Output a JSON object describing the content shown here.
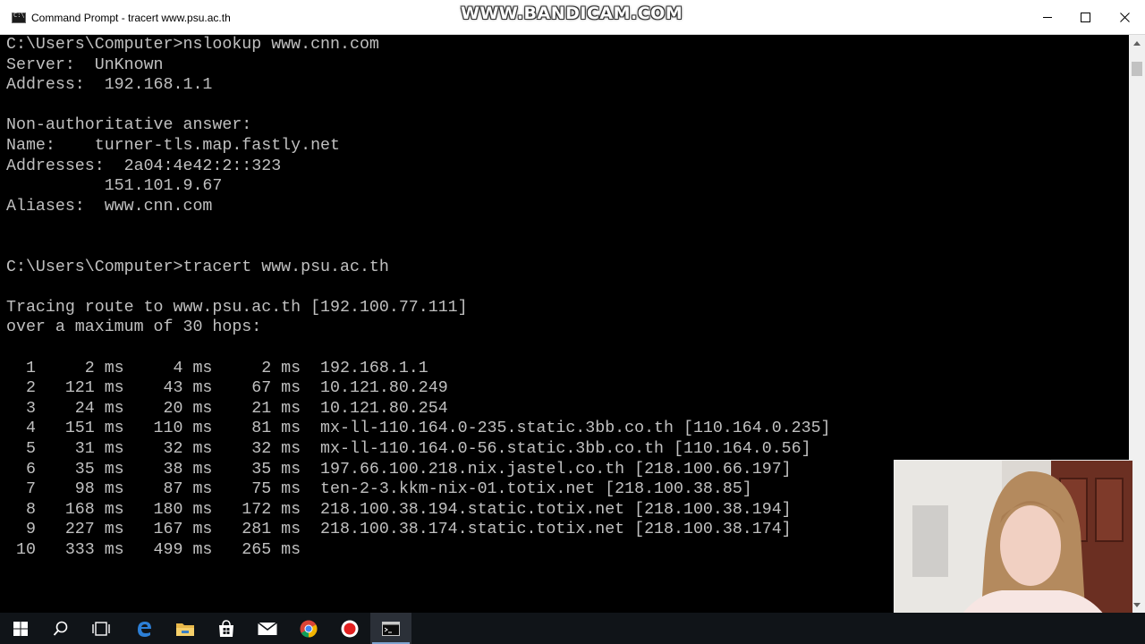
{
  "window": {
    "title": "Command Prompt - tracert  www.psu.ac.th",
    "watermark": "WWW.BANDICAM.COM",
    "minimize_icon": "minimize-icon",
    "maximize_icon": "maximize-icon",
    "close_icon": "close-icon"
  },
  "console": {
    "lines": [
      "C:\\Users\\Computer>nslookup www.cnn.com",
      "Server:  UnKnown",
      "Address:  192.168.1.1",
      "",
      "Non-authoritative answer:",
      "Name:    turner-tls.map.fastly.net",
      "Addresses:  2a04:4e42:2::323",
      "          151.101.9.67",
      "Aliases:  www.cnn.com",
      "",
      "",
      "C:\\Users\\Computer>tracert www.psu.ac.th",
      "",
      "Tracing route to www.psu.ac.th [192.100.77.111]",
      "over a maximum of 30 hops:",
      "",
      "  1     2 ms     4 ms     2 ms  192.168.1.1",
      "  2   121 ms    43 ms    67 ms  10.121.80.249",
      "  3    24 ms    20 ms    21 ms  10.121.80.254",
      "  4   151 ms   110 ms    81 ms  mx-ll-110.164.0-235.static.3bb.co.th [110.164.0.235]",
      "  5    31 ms    32 ms    32 ms  mx-ll-110.164.0-56.static.3bb.co.th [110.164.0.56]",
      "  6    35 ms    38 ms    35 ms  197.66.100.218.nix.jastel.co.th [218.100.66.197]",
      "  7    98 ms    87 ms    75 ms  ten-2-3.kkm-nix-01.totix.net [218.100.38.85]",
      "  8   168 ms   180 ms   172 ms  218.100.38.194.static.totix.net [218.100.38.194]",
      "  9   227 ms   167 ms   281 ms  218.100.38.174.static.totix.net [218.100.38.174]",
      " 10   333 ms   499 ms   265 ms"
    ]
  },
  "taskbar": {
    "items": [
      {
        "name": "start-icon"
      },
      {
        "name": "search-icon"
      },
      {
        "name": "task-view-icon"
      },
      {
        "name": "edge-icon"
      },
      {
        "name": "file-explorer-icon"
      },
      {
        "name": "store-icon"
      },
      {
        "name": "mail-icon"
      },
      {
        "name": "chrome-icon"
      },
      {
        "name": "record-icon"
      },
      {
        "name": "command-prompt-icon"
      }
    ]
  },
  "webcam": {
    "description_icon": "webcam-overlay"
  },
  "colors": {
    "console_text": "#c0c0c0",
    "console_bg": "#000000",
    "taskbar_bg": "#101418",
    "taskbar_accent": "#7da2ce"
  }
}
